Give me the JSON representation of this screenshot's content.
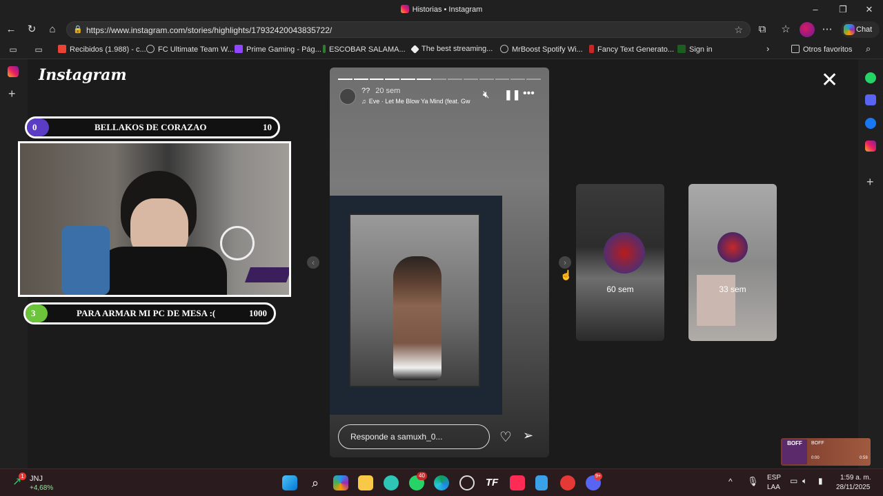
{
  "window": {
    "title": "Historias • Instagram"
  },
  "browser": {
    "url": "https://www.instagram.com/stories/highlights/17932420043835722/",
    "chat_label": "Chat"
  },
  "bookmarks": {
    "items": [
      {
        "label": "Recibidos (1.988) - c...",
        "color": "#ea4335"
      },
      {
        "label": "FC Ultimate Team W...",
        "color": "#9e9e9e"
      },
      {
        "label": "Prime Gaming - Pág...",
        "color": "#9146ff"
      },
      {
        "label": "ESCOBAR SALAMA...",
        "color": "#2e7d32"
      },
      {
        "label": "The best streaming...",
        "color": "#eeeeee"
      },
      {
        "label": "MrBoost Spotify Wi...",
        "color": "#9e9e9e"
      },
      {
        "label": "Fancy Text Generato...",
        "color": "#c62828"
      },
      {
        "label": "Sign in",
        "color": "#1b5e20"
      }
    ],
    "others": "Otros favoritos"
  },
  "instagram": {
    "logo": "Instagram",
    "story": {
      "username": "??",
      "time": "20 sem",
      "song": "Eve · Let Me Blow Ya Mind (feat. Gw",
      "reply_placeholder": "Responde a samuxh_0...",
      "segments_total": 13,
      "segments_done": 6
    },
    "previews": [
      {
        "time": "60 sem"
      },
      {
        "time": "33 sem"
      }
    ]
  },
  "overlay": {
    "goal_top": {
      "left_value": "0",
      "title": "BELLAKOS DE CORAZAO",
      "right_value": "10",
      "color": "#5b3cc4"
    },
    "goal_bottom": {
      "left_value": "3",
      "title": "PARA ARMAR MI PC DE MESA :(",
      "right_value": "1000",
      "color": "#6bc43a"
    }
  },
  "mini_player": {
    "title": "BOFF",
    "time_start": "0:00",
    "time_end": "0:59"
  },
  "taskbar": {
    "stock_name": "JNJ",
    "stock_change": "+4,68%",
    "stock_badge": "1",
    "whatsapp_badge": "40",
    "discord_badge": "9+",
    "lang_line1": "ESP",
    "lang_line2": "LAA",
    "time": "1:59 a. m.",
    "date": "28/11/2025"
  }
}
